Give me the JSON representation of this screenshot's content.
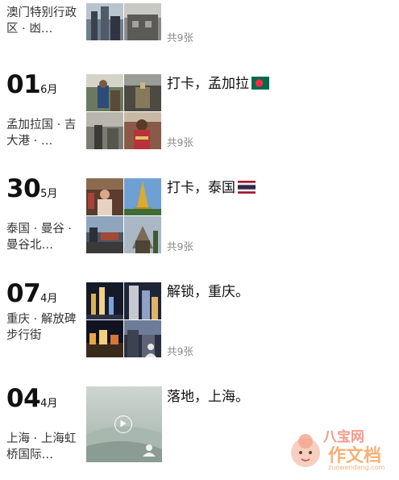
{
  "entries": [
    {
      "day": "",
      "month": "",
      "location": "澳门特别行政区 · 凼…",
      "caption": "",
      "count": "共9张"
    },
    {
      "day": "01",
      "month": "6月",
      "location": "孟加拉国 · 吉大港 · …",
      "caption": "打卡，孟加拉",
      "count": "共9张",
      "flag": "bangladesh-flag-icon"
    },
    {
      "day": "30",
      "month": "5月",
      "location": "泰国 · 曼谷 · 曼谷北…",
      "caption": "打卡，泰国",
      "count": "共9张",
      "flag": "thailand-flag-icon"
    },
    {
      "day": "07",
      "month": "4月",
      "location": "重庆 · 解放碑步行街",
      "caption": "解锁，重庆。",
      "count": "共9张"
    },
    {
      "day": "04",
      "month": "4月",
      "location": "上海 · 上海虹桥国际…",
      "caption": "落地，上海。",
      "count": ""
    }
  ],
  "watermark": {
    "text": "作文档",
    "subtext": "zuowendang.com",
    "brand": "八宝网"
  },
  "colors": {
    "bangladesh_green": "#006a4e",
    "bangladesh_red": "#f42a41",
    "thai_red": "#a51931",
    "thai_blue": "#2d2a4a"
  }
}
